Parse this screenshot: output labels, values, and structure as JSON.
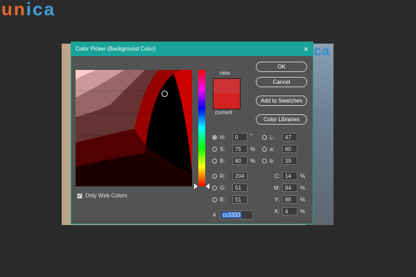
{
  "logo": {
    "part1": "un",
    "part2": "ica"
  },
  "background": {
    "logo_fragment": "ca"
  },
  "dialog": {
    "title": "Color Picker (Background Color)",
    "close_label": "×",
    "new_label": "new",
    "current_label": "current",
    "new_color": "#cc3333",
    "current_color": "#d42222",
    "buttons": {
      "ok": "OK",
      "cancel": "Cancel",
      "add_to_swatches": "Add to Swatches",
      "color_libraries": "Color Libraries"
    },
    "only_web_colors": {
      "label": "Only Web Colors",
      "checked": true,
      "check_mark": "✓"
    },
    "hsb": {
      "h": {
        "label": "H:",
        "value": "0",
        "unit": "°",
        "selected": true
      },
      "s": {
        "label": "S:",
        "value": "75",
        "unit": "%"
      },
      "b": {
        "label": "B:",
        "value": "80",
        "unit": "%"
      }
    },
    "rgb": {
      "r": {
        "label": "R:",
        "value": "204"
      },
      "g": {
        "label": "G:",
        "value": "51"
      },
      "b": {
        "label": "B:",
        "value": "51"
      }
    },
    "lab": {
      "l": {
        "label": "L:",
        "value": "47"
      },
      "a": {
        "label": "a:",
        "value": "60"
      },
      "b": {
        "label": "b:",
        "value": "39"
      }
    },
    "cmyk": {
      "c": {
        "label": "C:",
        "value": "14",
        "unit": "%"
      },
      "m": {
        "label": "M:",
        "value": "94",
        "unit": "%"
      },
      "y": {
        "label": "Y:",
        "value": "88",
        "unit": "%"
      },
      "k": {
        "label": "K:",
        "value": "4",
        "unit": "%"
      }
    },
    "hex": {
      "label": "#",
      "value": "cc3333"
    },
    "colors": {
      "title_bar": "#1aa39b",
      "dialog_bg": "#535353",
      "accent_selection": "#2f6fcc"
    }
  }
}
